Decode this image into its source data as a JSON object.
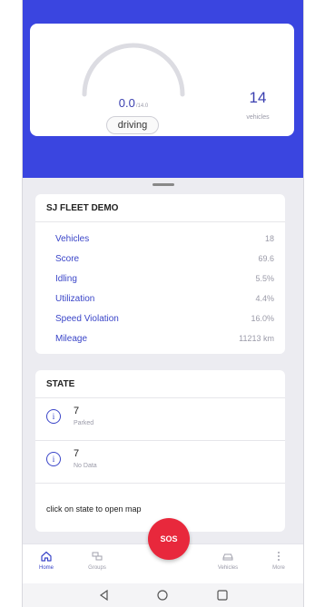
{
  "header": {
    "gauge_value": "0.0",
    "gauge_max": "/14.0",
    "gauge_status": "driving",
    "vehicles_count": "14",
    "vehicles_label": "vehicles"
  },
  "fleet": {
    "title": "SJ FLEET DEMO",
    "rows": [
      {
        "label": "Vehicles",
        "value": "18"
      },
      {
        "label": "Score",
        "value": "69.6"
      },
      {
        "label": "Idling",
        "value": "5.5%"
      },
      {
        "label": "Utilization",
        "value": "4.4%"
      },
      {
        "label": "Speed Violation",
        "value": "16.0%"
      },
      {
        "label": "Mileage",
        "value": "11213 km"
      }
    ]
  },
  "state": {
    "title": "STATE",
    "items": [
      {
        "count": "7",
        "label": "Parked"
      },
      {
        "count": "7",
        "label": "No Data"
      }
    ],
    "hint": "click on state to open map"
  },
  "sos_label": "SOS",
  "nav": {
    "items": [
      {
        "label": "Home",
        "icon": "home-icon"
      },
      {
        "label": "Groups",
        "icon": "groups-icon"
      },
      {
        "label": "Vehicles",
        "icon": "car-icon"
      },
      {
        "label": "More",
        "icon": "more-icon"
      }
    ],
    "active": "Home"
  },
  "colors": {
    "accent": "#3a45e0",
    "link": "#3a45c8",
    "sos": "#e8283c"
  }
}
